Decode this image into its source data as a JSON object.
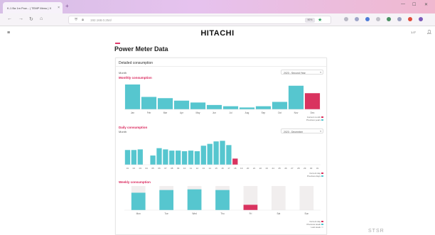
{
  "browser": {
    "tab_title": "K-1 Ba 1m Pow... | TEMP Menu | X",
    "new_tab": "+",
    "url": "192.168.0.254/",
    "zoom": "90%"
  },
  "header": {
    "brand": "HITACHI",
    "lang": "1.0°",
    "menu_icon": "hamburger-menu-icon",
    "user_icon": "user-icon"
  },
  "page": {
    "title": "Power Meter Data"
  },
  "card": {
    "title": "Detailed consumption",
    "accent_colors": {
      "teal": "#56c6cf",
      "red": "#d9335f"
    },
    "monthly": {
      "label": "Month",
      "section_title": "Monthly consumption",
      "select_value": "2023 - Second Year",
      "legend": [
        "Current month",
        "Previous years"
      ]
    },
    "daily": {
      "label": "Month",
      "section_title": "Daily consumption",
      "select_value": "2023 - December",
      "legend": [
        "Current day",
        "Previous days"
      ]
    },
    "weekly": {
      "section_title": "Weekly consumption",
      "legend": [
        "Current day",
        "Previous week",
        "Last week"
      ]
    }
  },
  "chart_data": [
    {
      "type": "bar",
      "title": "Monthly consumption",
      "categories": [
        "Jan",
        "Feb",
        "Mar",
        "Apr",
        "May",
        "Jun",
        "Jul",
        "Aug",
        "Sep",
        "Oct",
        "Nov",
        "Dec"
      ],
      "series": [
        {
          "name": "Previous years",
          "values": [
            40,
            20,
            18,
            14,
            11,
            7,
            5,
            3,
            5,
            12,
            38,
            0
          ]
        },
        {
          "name": "Current month",
          "values": [
            0,
            0,
            0,
            0,
            0,
            0,
            0,
            0,
            0,
            0,
            0,
            26
          ]
        }
      ],
      "ylim": [
        0,
        48
      ]
    },
    {
      "type": "bar",
      "title": "Daily consumption",
      "categories": [
        "01",
        "02",
        "03",
        "04",
        "05",
        "06",
        "07",
        "08",
        "09",
        "10",
        "11",
        "12",
        "13",
        "14",
        "15",
        "16",
        "17",
        "18",
        "19",
        "20",
        "21",
        "22",
        "23",
        "24",
        "25",
        "26",
        "27",
        "28",
        "29",
        "30",
        "31"
      ],
      "series": [
        {
          "name": "Previous days",
          "values": [
            24,
            24,
            25,
            0,
            15,
            27,
            25,
            23,
            23,
            22,
            23,
            22,
            31,
            34,
            38,
            39,
            32,
            0,
            0,
            0,
            0,
            0,
            0,
            0,
            0,
            0,
            0,
            0,
            0,
            0,
            0
          ]
        },
        {
          "name": "Current day",
          "values": [
            0,
            0,
            0,
            0,
            0,
            0,
            0,
            0,
            0,
            0,
            0,
            0,
            0,
            0,
            0,
            0,
            0,
            10,
            0,
            0,
            0,
            0,
            0,
            0,
            0,
            0,
            0,
            0,
            0,
            0,
            0
          ]
        }
      ],
      "ylim": [
        0,
        44
      ]
    },
    {
      "type": "bar",
      "title": "Weekly consumption",
      "categories": [
        "Mon",
        "Tue",
        "Wed",
        "Thu",
        "Fri",
        "Sat",
        "Sun"
      ],
      "series": [
        {
          "name": "Previous week",
          "values": [
            26,
            30,
            31,
            30,
            0,
            0,
            0
          ]
        },
        {
          "name": "Current day",
          "values": [
            0,
            0,
            0,
            0,
            8,
            0,
            0
          ]
        }
      ],
      "ylim": [
        0,
        36
      ]
    }
  ]
}
